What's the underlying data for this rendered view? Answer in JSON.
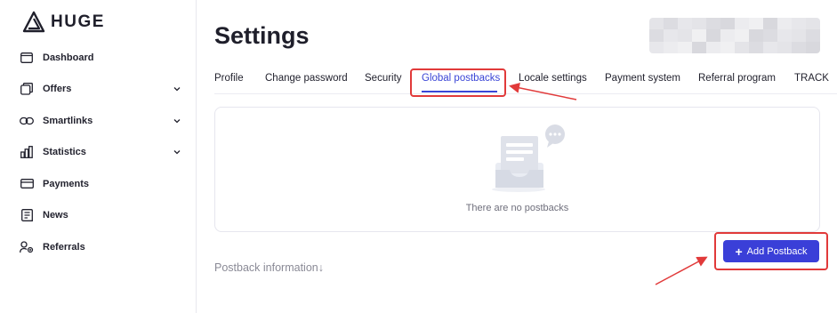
{
  "brand": {
    "name": "HUGE"
  },
  "sidebar": {
    "items": [
      {
        "label": "Dashboard",
        "icon": "dashboard-icon",
        "has_submenu": false
      },
      {
        "label": "Offers",
        "icon": "offers-icon",
        "has_submenu": true
      },
      {
        "label": "Smartlinks",
        "icon": "link-icon",
        "has_submenu": true
      },
      {
        "label": "Statistics",
        "icon": "bar-chart-icon",
        "has_submenu": true
      },
      {
        "label": "Payments",
        "icon": "card-icon",
        "has_submenu": false
      },
      {
        "label": "News",
        "icon": "news-icon",
        "has_submenu": false
      },
      {
        "label": "Referrals",
        "icon": "referrals-icon",
        "has_submenu": false
      }
    ]
  },
  "page": {
    "title": "Settings"
  },
  "tabs": [
    {
      "label": "Profile",
      "active": false
    },
    {
      "label": "Change password",
      "active": false
    },
    {
      "label": "Security",
      "active": false
    },
    {
      "label": "Global postbacks",
      "active": true
    },
    {
      "label": "Locale settings",
      "active": false
    },
    {
      "label": "Payment system",
      "active": false
    },
    {
      "label": "Referral program",
      "active": false
    },
    {
      "label": "TRACK",
      "active": false
    }
  ],
  "empty_state": {
    "text": "There are no postbacks"
  },
  "postback_info": {
    "label": "Postback information",
    "icon": "arrow-down-icon"
  },
  "actions": {
    "add_postback": "Add Postback"
  },
  "colors": {
    "accent": "#3a45d6",
    "button": "#3a3fd8",
    "annotation": "#e13a3a"
  }
}
